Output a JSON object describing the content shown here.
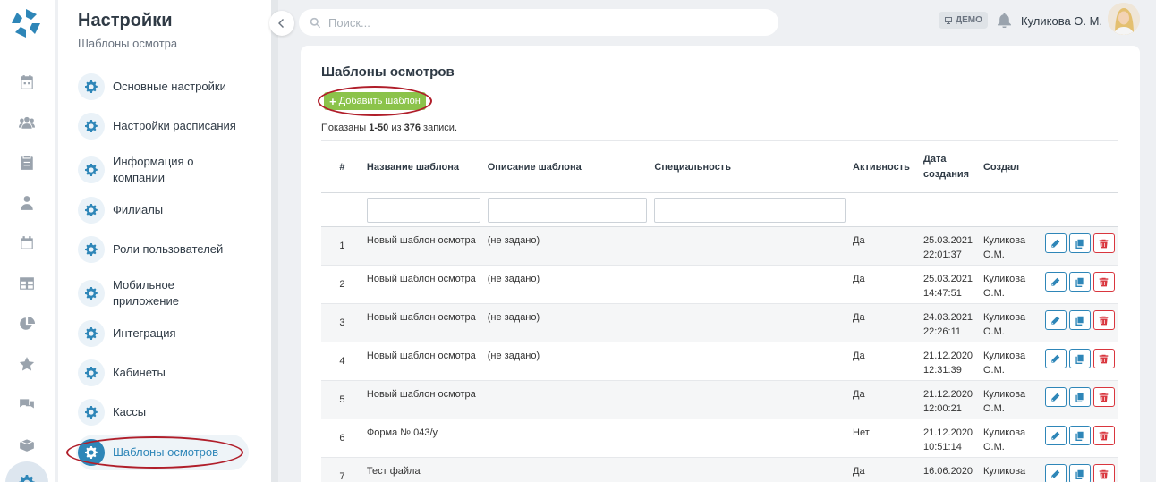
{
  "sidebar": {
    "title": "Настройки",
    "subtitle": "Шаблоны осмотра",
    "items": [
      {
        "label": "Основные настройки"
      },
      {
        "label": "Настройки расписания"
      },
      {
        "label": "Информация о компании"
      },
      {
        "label": "Филиалы"
      },
      {
        "label": "Роли пользователей"
      },
      {
        "label": "Мобильное приложение"
      },
      {
        "label": "Интеграция"
      },
      {
        "label": "Кабинеты"
      },
      {
        "label": "Кассы"
      },
      {
        "label": "Шаблоны осмотров"
      }
    ]
  },
  "rail": {
    "icons": [
      "calendar-icon",
      "users-icon",
      "clipboard-icon",
      "doctor-icon",
      "schedule-icon",
      "table-icon",
      "pie-chart-icon",
      "star-icon",
      "chat-icon",
      "boxes-icon",
      "gear-icon"
    ]
  },
  "header": {
    "search_placeholder": "Поиск...",
    "demo_badge": "ДЕМО",
    "user_name": "Куликова О. М."
  },
  "main": {
    "title": "Шаблоны осмотров",
    "add_button": "Добавить шаблон",
    "summary_prefix": "Показаны ",
    "summary_range": "1-50",
    "summary_mid": " из ",
    "summary_total": "376",
    "summary_suffix": " записи.",
    "columns": [
      "#",
      "Название шаблона",
      "Описание шаблона",
      "Специальность",
      "Активность",
      "Дата создания",
      "Создал"
    ],
    "rows": [
      {
        "num": "1",
        "name": "Новый шаблон осмотра",
        "desc": "(не задано)",
        "spec": "",
        "active": "Да",
        "date": "25.03.2021",
        "time": "22:01:37",
        "author": "Куликова О.М."
      },
      {
        "num": "2",
        "name": "Новый шаблон осмотра",
        "desc": "(не задано)",
        "spec": "",
        "active": "Да",
        "date": "25.03.2021",
        "time": "14:47:51",
        "author": "Куликова О.М."
      },
      {
        "num": "3",
        "name": "Новый шаблон осмотра",
        "desc": "(не задано)",
        "spec": "",
        "active": "Да",
        "date": "24.03.2021",
        "time": "22:26:11",
        "author": "Куликова О.М."
      },
      {
        "num": "4",
        "name": "Новый шаблон осмотра",
        "desc": "(не задано)",
        "spec": "",
        "active": "Да",
        "date": "21.12.2020",
        "time": "12:31:39",
        "author": "Куликова О.М."
      },
      {
        "num": "5",
        "name": "Новый шаблон осмотра",
        "desc": "",
        "spec": "",
        "active": "Да",
        "date": "21.12.2020",
        "time": "12:00:21",
        "author": "Куликова О.М."
      },
      {
        "num": "6",
        "name": "Форма № 043/у",
        "desc": "",
        "spec": "",
        "active": "Нет",
        "date": "21.12.2020",
        "time": "10:51:14",
        "author": "Куликова О.М."
      },
      {
        "num": "7",
        "name": "Тест файла",
        "desc": "",
        "spec": "",
        "active": "Да",
        "date": "16.06.2020",
        "time": "",
        "author": "Куликова"
      }
    ]
  },
  "colors": {
    "accent": "#2e86b8",
    "add_button": "#8bc34a",
    "delete": "#d9363e",
    "highlight_oval": "#b01e2a"
  }
}
